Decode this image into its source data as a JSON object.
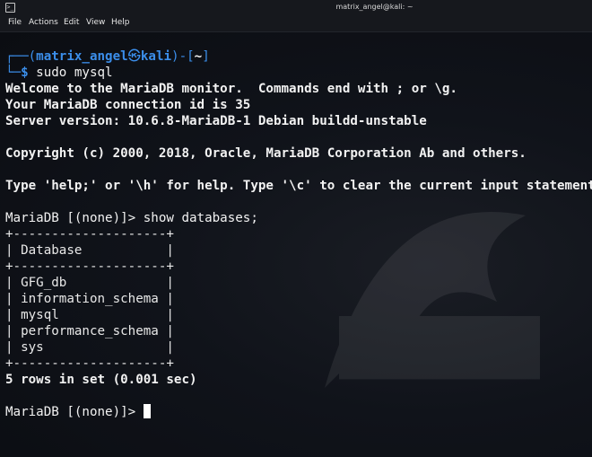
{
  "window": {
    "app_icon_glyph": ">_",
    "title": "matrix_angel@kali: ~"
  },
  "menu": {
    "items": [
      "File",
      "Actions",
      "Edit",
      "View",
      "Help"
    ]
  },
  "prompt": {
    "open_bracket": "┌──(",
    "user": "matrix_angel",
    "at_glyph": "㉿",
    "host": "kali",
    "close_mid": ")-[",
    "cwd": "~",
    "close_bracket": "]",
    "arrow": "└─",
    "dollar": "$",
    "command": " sudo mysql"
  },
  "output": {
    "welcome": "Welcome to the MariaDB monitor.  Commands end with ; or \\g.",
    "connection": "Your MariaDB connection id is 35",
    "version": "Server version: 10.6.8-MariaDB-1 Debian buildd-unstable",
    "copyright": "Copyright (c) 2000, 2018, Oracle, MariaDB Corporation Ab and others.",
    "help": "Type 'help;' or '\\h' for help. Type '\\c' to clear the current input statement.",
    "query_prompt": "MariaDB [(none)]> show databases;",
    "table_top": "+--------------------+",
    "table_header": "| Database           |",
    "table_sep": "+--------------------+",
    "rows": [
      "| GFG_db             |",
      "| information_schema |",
      "| mysql              |",
      "| performance_schema |",
      "| sys                |"
    ],
    "table_bottom": "+--------------------+",
    "result": "5 rows in set (0.001 sec)",
    "final_prompt": "MariaDB [(none)]> "
  },
  "colors": {
    "prompt_blue": "#3b8eea",
    "text": "#f2f2f2",
    "background": "#0d0f14"
  }
}
